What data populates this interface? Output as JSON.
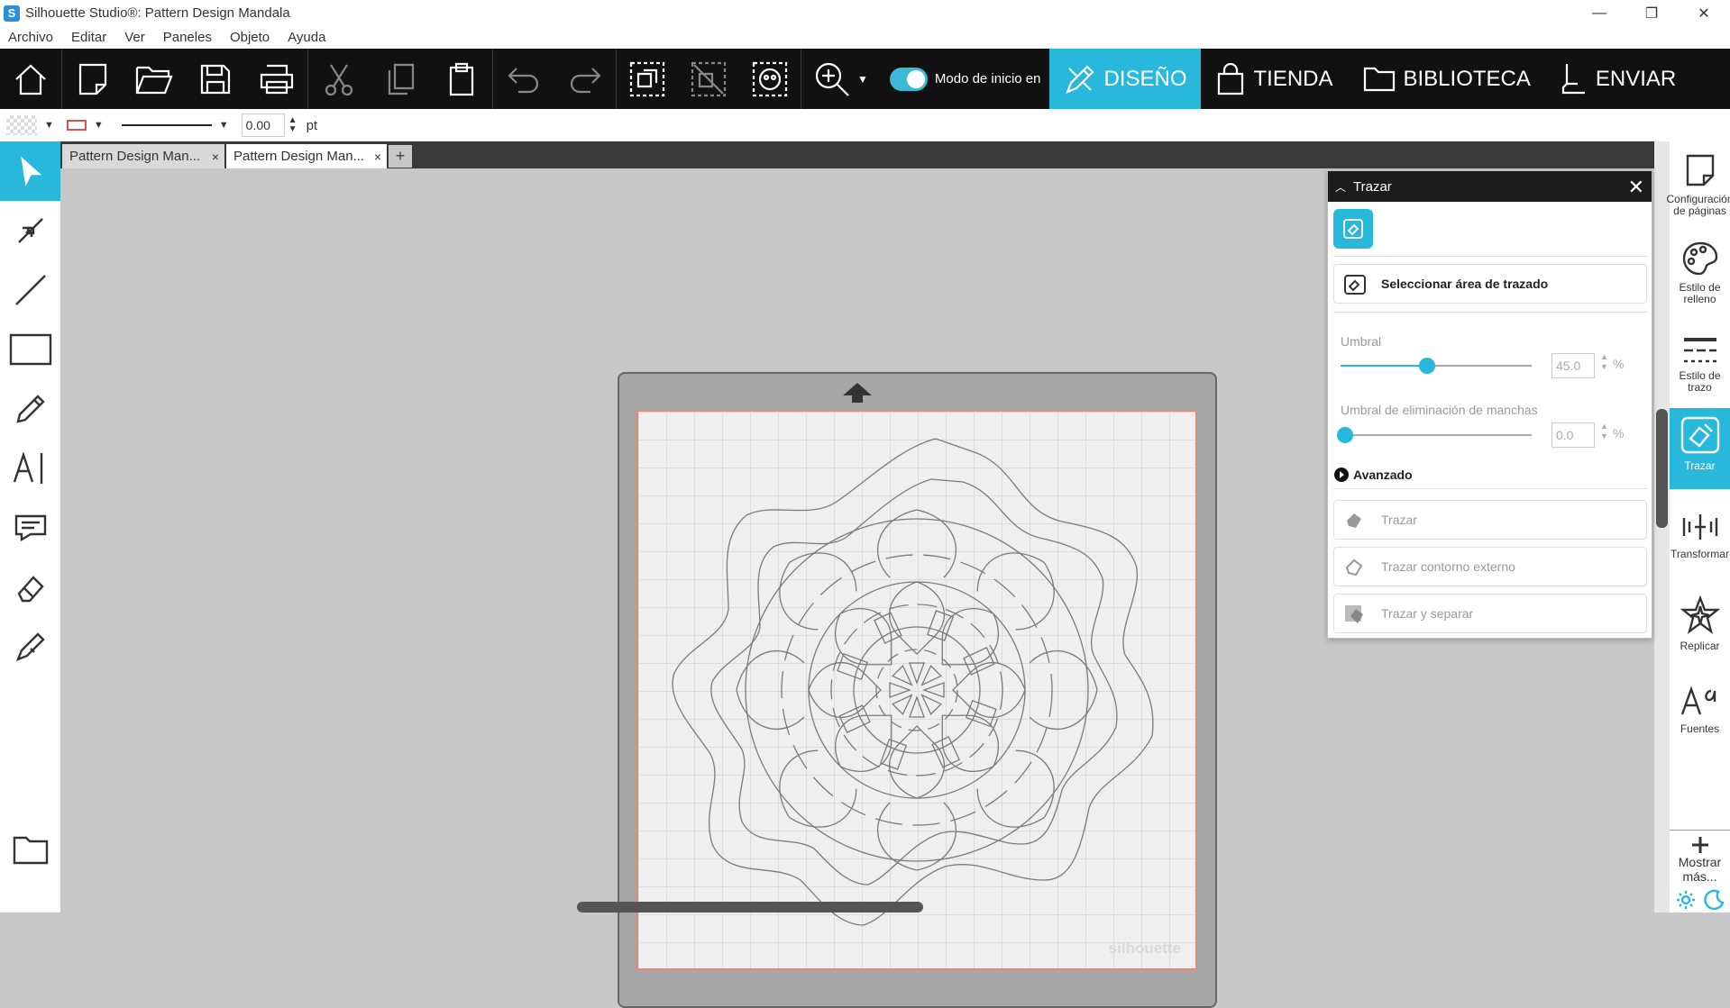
{
  "window": {
    "title": "Silhouette Studio®: Pattern Design Mandala",
    "app_icon": "S",
    "controls": [
      "—",
      "❐",
      "✕"
    ]
  },
  "menu": [
    "Archivo",
    "Editar",
    "Ver",
    "Paneles",
    "Objeto",
    "Ayuda"
  ],
  "toolbar": {
    "mode_label": "Modo de inicio en",
    "zoom_caret": "▼",
    "nav": [
      "DISEÑO",
      "TIENDA",
      "BIBLIOTECA",
      "ENVIAR"
    ]
  },
  "propbar": {
    "line_width": "0.00",
    "unit": "pt",
    "caret": "▼",
    "spin_up": "▲",
    "spin_down": "▼"
  },
  "tabs": [
    {
      "label": "Pattern Design Man...",
      "close": "×"
    },
    {
      "label": "Pattern Design Man...",
      "close": "×"
    }
  ],
  "tab_add": "+",
  "canvas": {
    "watermark": "silhouette"
  },
  "trace_panel": {
    "title": "Trazar",
    "close": "✕",
    "select_area": "Seleccionar área de trazado",
    "threshold_label": "Umbral",
    "threshold_value": "45.0",
    "threshold_percent": 45,
    "unit": "%",
    "speckle_label": "Umbral de eliminación de manchas",
    "speckle_value": "0.0",
    "advanced_label": "Avanzado",
    "buttons": [
      "Trazar",
      "Trazar contorno externo",
      "Trazar y separar"
    ]
  },
  "right_panel": [
    {
      "label": "Configuración de páginas",
      "icon": "page-setup-icon"
    },
    {
      "label": "Estilo de relleno",
      "icon": "fill-style-icon"
    },
    {
      "label": "Estilo de trazo",
      "icon": "line-style-icon"
    },
    {
      "label": "Trazar",
      "icon": "trace-icon"
    },
    {
      "label": "Transformar",
      "icon": "transform-icon"
    },
    {
      "label": "Replicar",
      "icon": "replicate-icon"
    },
    {
      "label": "Fuentes",
      "icon": "fonts-icon"
    },
    {
      "label": "Mostrar más...",
      "icon": "plus-icon"
    }
  ],
  "colors": {
    "accent": "#27b8db",
    "toolbar_bg": "#111111",
    "mat": "#a6a6a6",
    "cut_border": "#e8887a"
  }
}
